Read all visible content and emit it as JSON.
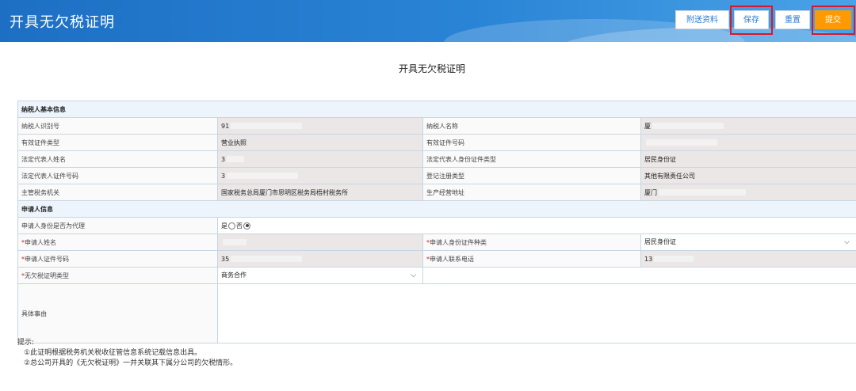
{
  "header": {
    "title": "开具无欠税证明",
    "buttons": {
      "attach": "附送资料",
      "save": "保存",
      "reset": "重置",
      "submit": "提交"
    }
  },
  "form": {
    "title": "开具无欠税证明",
    "taxpayer_section": "纳税人基本信息",
    "taxpayer": {
      "id_label": "纳税人识别号",
      "id_value": "91",
      "name_label": "纳税人名称",
      "name_value": "厦",
      "cert_type_label": "有效证件类型",
      "cert_type_value": "营业执照",
      "cert_no_label": "有效证件号码",
      "cert_no_value": "",
      "legal_name_label": "法定代表人姓名",
      "legal_name_value": "3",
      "legal_id_type_label": "法定代表人身份证件类型",
      "legal_id_type_value": "居民身份证",
      "legal_id_no_label": "法定代表人证件号码",
      "legal_id_no_value": "3",
      "reg_type_label": "登记注册类型",
      "reg_type_value": "其他有限责任公司",
      "authority_label": "主管税务机关",
      "authority_value": "国家税务总局厦门市思明区税务局梧村税务所",
      "address_label": "生产经营地址",
      "address_value": "厦门"
    },
    "applicant_section": "申请人信息",
    "applicant": {
      "is_agent_label": "申请人身份是否为代理",
      "yes_label": "是",
      "no_label": "否",
      "name_label": "申请人姓名",
      "name_value": "",
      "id_type_label": "申请人身份证件种类",
      "id_type_value": "居民身份证",
      "id_no_label": "申请人证件号码",
      "id_no_value": "35",
      "phone_label": "申请人联系电话",
      "phone_value": "13",
      "cert_kind_label": "无欠税证明类型",
      "cert_kind_value": "商务合作",
      "reason_label": "具体事由",
      "reason_value": ""
    },
    "required_mark": "*"
  },
  "notes": {
    "title": "提示:",
    "items": [
      "①此证明根据税务机关税收征管信息系统记载信息出具。",
      "②总公司开具的《无欠税证明》一并关联其下属分公司的欠税情形。"
    ]
  }
}
